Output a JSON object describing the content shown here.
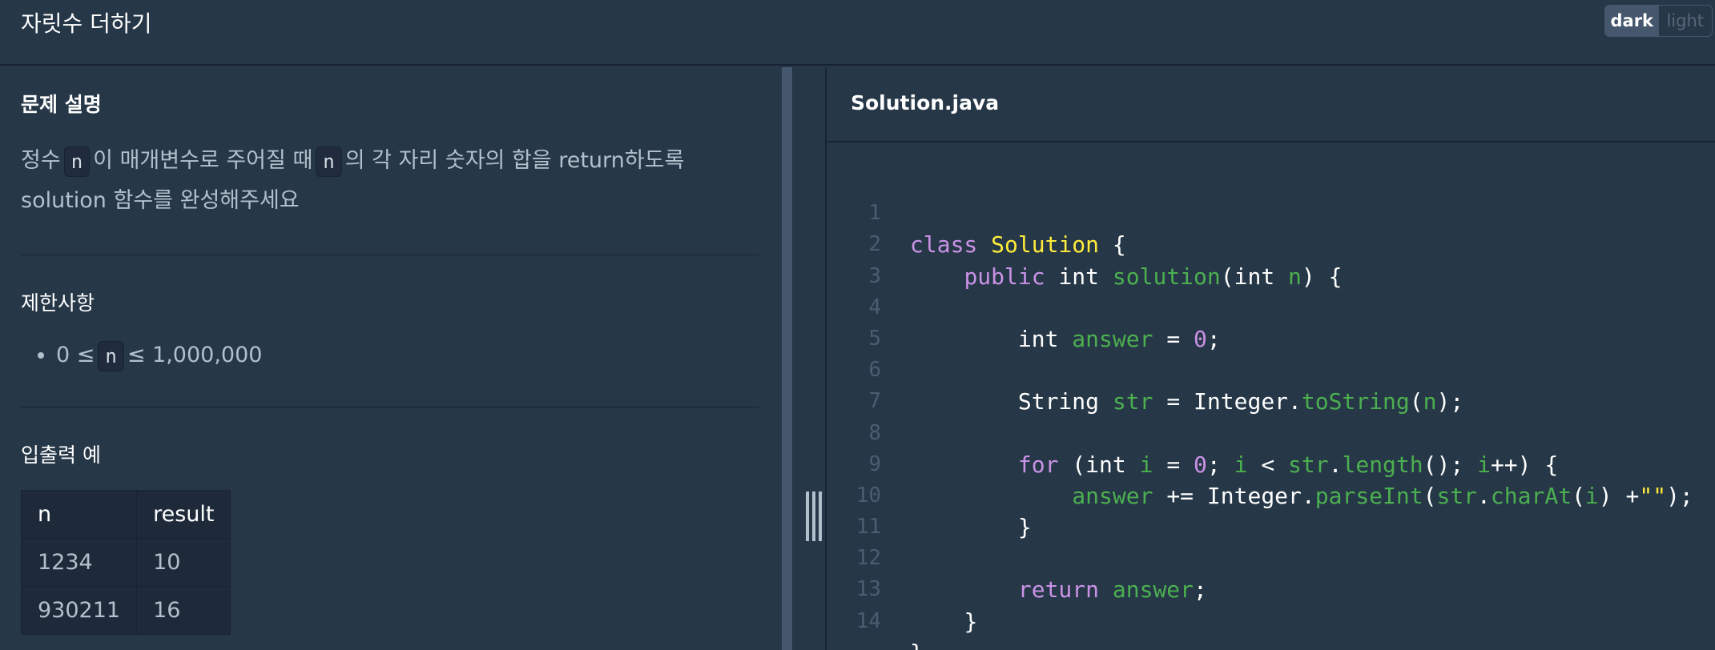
{
  "header": {
    "title": "자릿수 더하기",
    "theme_toggle": {
      "dark_label": "dark",
      "light_label": "light",
      "selected": "dark"
    }
  },
  "problem": {
    "description_heading": "문제 설명",
    "desc_part1": "정수",
    "desc_var1": "n",
    "desc_part2": "이 매개변수로 주어질 때",
    "desc_var2": "n",
    "desc_part3": "의 각 자리 숫자의 합을 return하도록",
    "desc_part4": "solution 함수를 완성해주세요",
    "constraints_heading": "제한사항",
    "constraint_prefix": "0 ≤",
    "constraint_var": "n",
    "constraint_suffix": "≤ 1,000,000",
    "examples_heading": "입출력 예",
    "examples_table": {
      "headers": [
        "n",
        "result"
      ],
      "rows": [
        [
          "1234",
          "10"
        ],
        [
          "930211",
          "16"
        ]
      ]
    }
  },
  "editor": {
    "file_name": "Solution.java",
    "line_numbers": [
      "1",
      "2",
      "3",
      "4",
      "5",
      "6",
      "7",
      "8",
      "9",
      "10",
      "11",
      "12",
      "13",
      "14"
    ],
    "tokens": {
      "l1": [
        "class",
        "Solution",
        "{"
      ],
      "l2": [
        "public",
        "int",
        "solution",
        "(",
        "int",
        "n",
        ") {"
      ],
      "l4": [
        "int",
        "answer",
        "=",
        "0",
        ";"
      ],
      "l6": [
        "String",
        "str",
        "= Integer.",
        "toString",
        "(",
        "n",
        ");"
      ],
      "l8": [
        "for",
        "(int",
        "i",
        "=",
        "0",
        ";",
        "i",
        "<",
        "str",
        ".",
        "length",
        "();",
        "i",
        "++) {"
      ],
      "l9": [
        "answer",
        "+= Integer.",
        "parseInt",
        "(",
        "str",
        ".",
        "charAt",
        "(",
        "i",
        ") +",
        "\"\"",
        ");"
      ],
      "l10": [
        "}"
      ],
      "l12": [
        "return",
        "answer",
        ";"
      ],
      "l13": [
        "}"
      ],
      "l14": [
        "}"
      ]
    }
  },
  "colors": {
    "background": "#263747",
    "keyword": "#c992e6",
    "class_name": "#ffeb3b",
    "identifier": "#4caf50",
    "text": "#ffffff"
  }
}
